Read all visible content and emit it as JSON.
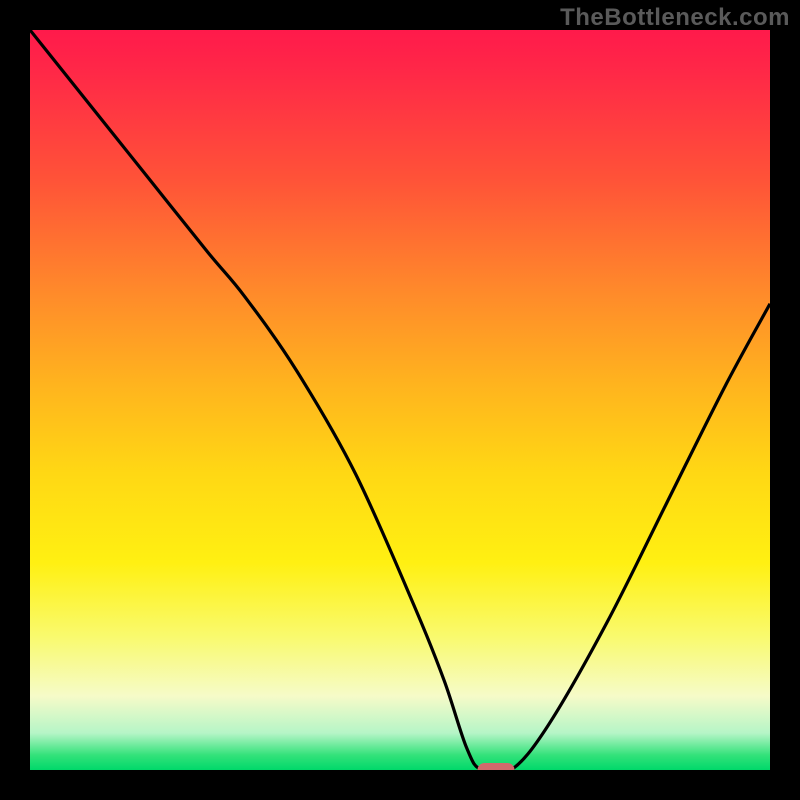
{
  "watermark": "TheBottleneck.com",
  "colors": {
    "frame": "#000000",
    "curve_stroke": "#000000",
    "marker_fill": "#d06a6c",
    "gradient_top": "#ff1a4b",
    "gradient_bottom": "#00d86a"
  },
  "chart_data": {
    "type": "line",
    "title": "",
    "xlabel": "",
    "ylabel": "",
    "xlim": [
      0,
      100
    ],
    "ylim": [
      0,
      100
    ],
    "grid": false,
    "legend": false,
    "description": "Bottleneck percentage curve; y is bottleneck %, x is relative component balance. Minimum near x≈62 with a short flat zero-bottleneck segment.",
    "series": [
      {
        "name": "bottleneck-curve",
        "x": [
          0,
          8,
          16,
          24,
          29,
          36,
          44,
          52,
          56,
          59,
          61,
          65,
          70,
          78,
          86,
          94,
          100
        ],
        "y": [
          100,
          90,
          80,
          70,
          64,
          54,
          40,
          22,
          12,
          3,
          0,
          0,
          6,
          20,
          36,
          52,
          63
        ]
      }
    ],
    "marker": {
      "x_center": 63,
      "width_pct": 5,
      "y": 0
    }
  }
}
